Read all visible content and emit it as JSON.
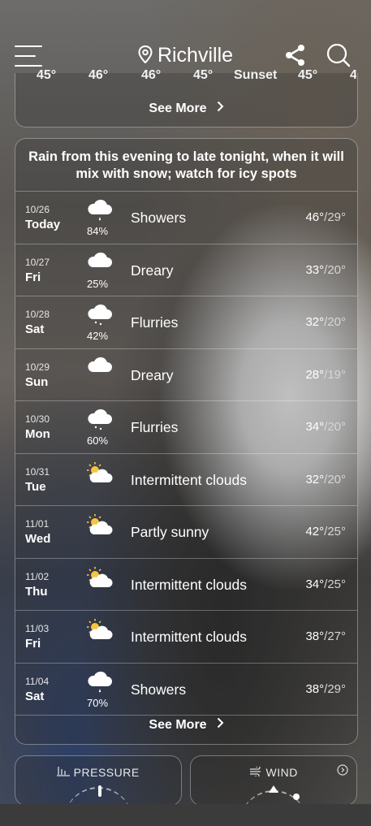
{
  "header": {
    "location": "Richville"
  },
  "hourly_partial": [
    "45°",
    "46°",
    "46°",
    "45°",
    "Sunset",
    "45°",
    "4"
  ],
  "see_more_top": "See More",
  "daily": {
    "summary": "Rain from this evening to late tonight, when it will mix with snow; watch for icy spots",
    "rows": [
      {
        "date": "10/26",
        "day": "Today",
        "icon": "rain-cloud-icon",
        "precip": "84%",
        "phrase": "Showers",
        "hi": "46°",
        "lo": "29°"
      },
      {
        "date": "10/27",
        "day": "Fri",
        "icon": "cloud-icon",
        "precip": "25%",
        "phrase": "Dreary",
        "hi": "33°",
        "lo": "20°"
      },
      {
        "date": "10/28",
        "day": "Sat",
        "icon": "snow-cloud-icon",
        "precip": "42%",
        "phrase": "Flurries",
        "hi": "32°",
        "lo": "20°"
      },
      {
        "date": "10/29",
        "day": "Sun",
        "icon": "cloud-icon",
        "precip": "",
        "phrase": "Dreary",
        "hi": "28°",
        "lo": "19°"
      },
      {
        "date": "10/30",
        "day": "Mon",
        "icon": "snow-cloud-icon",
        "precip": "60%",
        "phrase": "Flurries",
        "hi": "34°",
        "lo": "20°"
      },
      {
        "date": "10/31",
        "day": "Tue",
        "icon": "sun-cloud-icon",
        "precip": "",
        "phrase": "Intermittent clouds",
        "hi": "32°",
        "lo": "20°"
      },
      {
        "date": "11/01",
        "day": "Wed",
        "icon": "sun-cloud-icon",
        "precip": "",
        "phrase": "Partly sunny",
        "hi": "42°",
        "lo": "25°"
      },
      {
        "date": "11/02",
        "day": "Thu",
        "icon": "sun-cloud-icon",
        "precip": "",
        "phrase": "Intermittent clouds",
        "hi": "34°",
        "lo": "25°"
      },
      {
        "date": "11/03",
        "day": "Fri",
        "icon": "sun-cloud-icon",
        "precip": "",
        "phrase": "Intermittent clouds",
        "hi": "38°",
        "lo": "27°"
      },
      {
        "date": "11/04",
        "day": "Sat",
        "icon": "rain-cloud-icon",
        "precip": "70%",
        "phrase": "Showers",
        "hi": "38°",
        "lo": "29°"
      }
    ]
  },
  "see_more_bottom": "See More",
  "tiles": {
    "pressure": "PRESSURE",
    "wind": "WIND"
  }
}
